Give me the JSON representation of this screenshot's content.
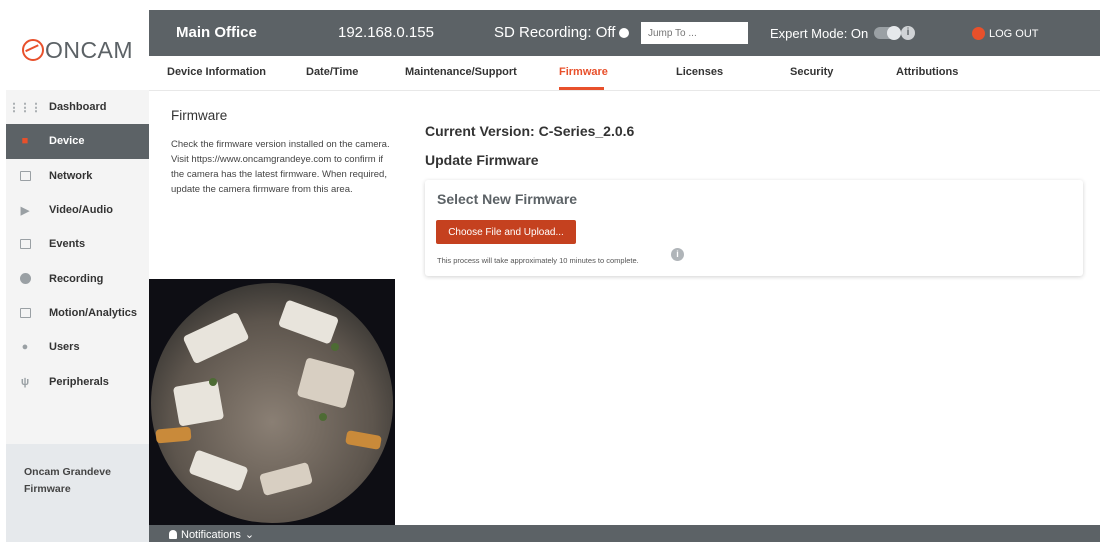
{
  "brand": {
    "logo_text": "ONCAM"
  },
  "sidebar": {
    "items": [
      {
        "label": "Dashboard",
        "icon": "grid-icon"
      },
      {
        "label": "Device",
        "icon": "camera-icon",
        "active": true
      },
      {
        "label": "Network",
        "icon": "server-icon"
      },
      {
        "label": "Video/Audio",
        "icon": "play-icon"
      },
      {
        "label": "Events",
        "icon": "calendar-icon"
      },
      {
        "label": "Recording",
        "icon": "record-icon"
      },
      {
        "label": "Motion/Analytics",
        "icon": "chart-icon"
      },
      {
        "label": "Users",
        "icon": "user-icon"
      },
      {
        "label": "Peripherals",
        "icon": "usb-icon"
      }
    ],
    "footer": {
      "line1": "Oncam Grandeve",
      "line2": "Firmware"
    }
  },
  "topbar": {
    "site_name": "Main Office",
    "ip": "192.168.0.155",
    "sd_recording": "SD Recording: Off",
    "jump_placeholder": "Jump To ...",
    "expert_mode": "Expert Mode: On",
    "logout": "LOG OUT"
  },
  "tabs": [
    {
      "label": "Device Information"
    },
    {
      "label": "Date/Time"
    },
    {
      "label": "Maintenance/Support"
    },
    {
      "label": "Firmware",
      "active": true
    },
    {
      "label": "Licenses"
    },
    {
      "label": "Security"
    },
    {
      "label": "Attributions"
    }
  ],
  "info": {
    "title": "Firmware",
    "description": "Check the firmware version installed on the camera. Visit https://www.oncamgrandeye.com to confirm if the camera has the latest firmware. When required, update the camera firmware from this area."
  },
  "main": {
    "current_version": "Current Version: C-Series_2.0.6",
    "update_title": "Update Firmware",
    "card": {
      "title": "Select New Firmware",
      "button": "Choose File and Upload...",
      "note": "This process will take approximately 10 minutes to complete."
    }
  },
  "bottombar": {
    "notifications": "Notifications"
  },
  "colors": {
    "accent": "#e8502b",
    "bar": "#5c6266",
    "button": "#c5411f"
  }
}
